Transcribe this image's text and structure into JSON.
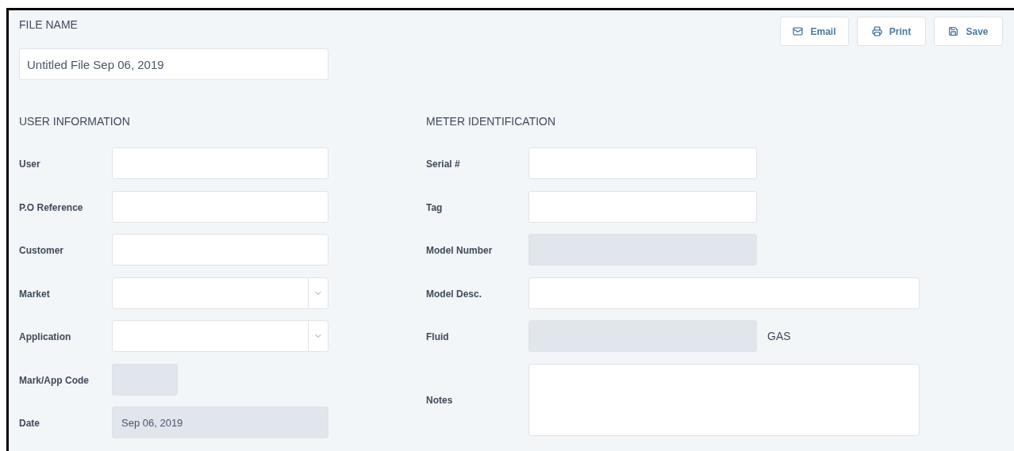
{
  "file_name": {
    "label": "FILE NAME",
    "value": "Untitled File Sep 06, 2019"
  },
  "buttons": [
    {
      "label": "Email",
      "kind": "email"
    },
    {
      "label": "Print",
      "kind": "print"
    },
    {
      "label": "Save",
      "kind": "save"
    }
  ],
  "user_information": {
    "title": "USER INFORMATION",
    "fields": [
      {
        "label": "User",
        "kind": "text",
        "disabled": false
      },
      {
        "label": "P.O Reference",
        "kind": "text",
        "disabled": false
      },
      {
        "label": "Customer",
        "kind": "text",
        "disabled": false
      },
      {
        "label": "Market",
        "kind": "select",
        "disabled": false
      },
      {
        "label": "Application",
        "kind": "select",
        "disabled": false
      },
      {
        "label": "Mark/App Code",
        "kind": "short",
        "disabled": true
      },
      {
        "label": "Date",
        "kind": "text",
        "disabled": true,
        "value": "Sep 06, 2019"
      }
    ]
  },
  "meter_identification": {
    "title": "METER IDENTIFICATION",
    "fields": [
      {
        "label": "Serial #",
        "kind": "text",
        "disabled": false
      },
      {
        "label": "Tag",
        "kind": "text",
        "disabled": false
      },
      {
        "label": "Model Number",
        "kind": "text",
        "disabled": true
      },
      {
        "label": "Model Desc.",
        "kind": "wide",
        "disabled": false
      },
      {
        "label": "Fluid",
        "kind": "text",
        "disabled": true,
        "suffix": "GAS"
      },
      {
        "label": "Notes",
        "kind": "textarea",
        "disabled": false
      }
    ]
  }
}
